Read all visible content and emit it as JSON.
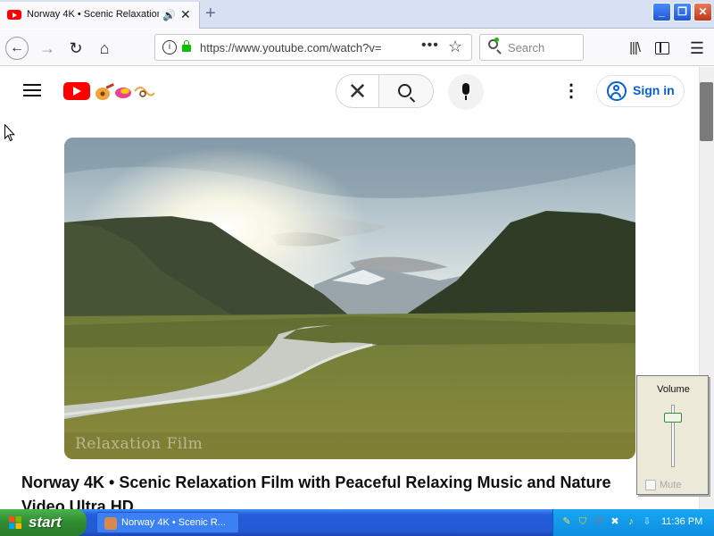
{
  "browser": {
    "tab": {
      "title": "Norway 4K • Scenic Relaxation",
      "audio_icon": "speaker-icon",
      "close_glyph": "✕"
    },
    "new_tab_glyph": "+",
    "window_buttons": {
      "minimize": "_",
      "maximize": "❐",
      "close": "✕"
    },
    "nav": {
      "back_glyph": "←",
      "forward_glyph": "→",
      "reload_glyph": "↻",
      "home_glyph": "⌂"
    },
    "url": "https://www.youtube.com/watch?v=",
    "url_more": "•••",
    "bookmark_glyph": "☆",
    "search_placeholder": "Search",
    "library_glyph": "|||\\",
    "menu_glyph": "☰"
  },
  "youtube": {
    "header": {
      "clear_glyph": "✕",
      "more_glyph": "⋮",
      "signin_label": "Sign in"
    },
    "video": {
      "watermark": "Relaxation Film",
      "title": "Norway 4K • Scenic Relaxation Film with Peaceful Relaxing Music and Nature Video Ultra HD"
    }
  },
  "volume_popup": {
    "label": "Volume",
    "mute_label": "Mute",
    "mute_checked": false,
    "level": 0.85
  },
  "taskbar": {
    "start_label": "start",
    "task_label": "Norway 4K • Scenic R...",
    "clock": "11:36 PM"
  },
  "colors": {
    "youtube_red": "#ff0000",
    "link_blue": "#065fd4",
    "xp_taskbar": "#245edb",
    "xp_start_green": "#3c9a3c"
  }
}
